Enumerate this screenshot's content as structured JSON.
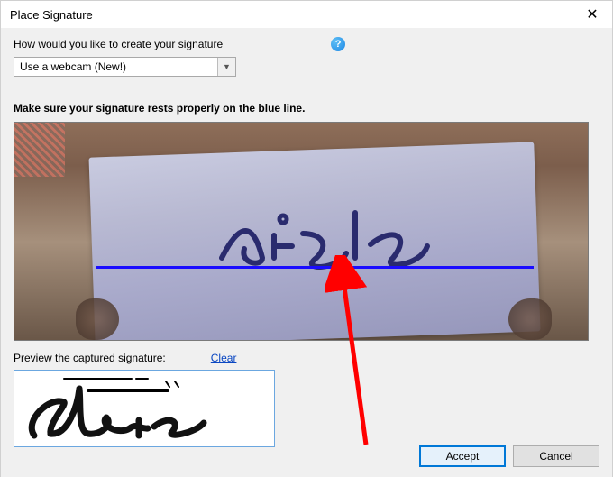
{
  "dialog": {
    "title": "Place Signature"
  },
  "prompt": {
    "how_label": "How would you like to create your signature"
  },
  "method_select": {
    "value": "Use a webcam (New!)"
  },
  "capture": {
    "instruction": "Make sure your signature rests properly on the blue line."
  },
  "preview": {
    "label": "Preview the captured signature:",
    "clear_label": "Clear"
  },
  "buttons": {
    "accept": "Accept",
    "cancel": "Cancel"
  }
}
